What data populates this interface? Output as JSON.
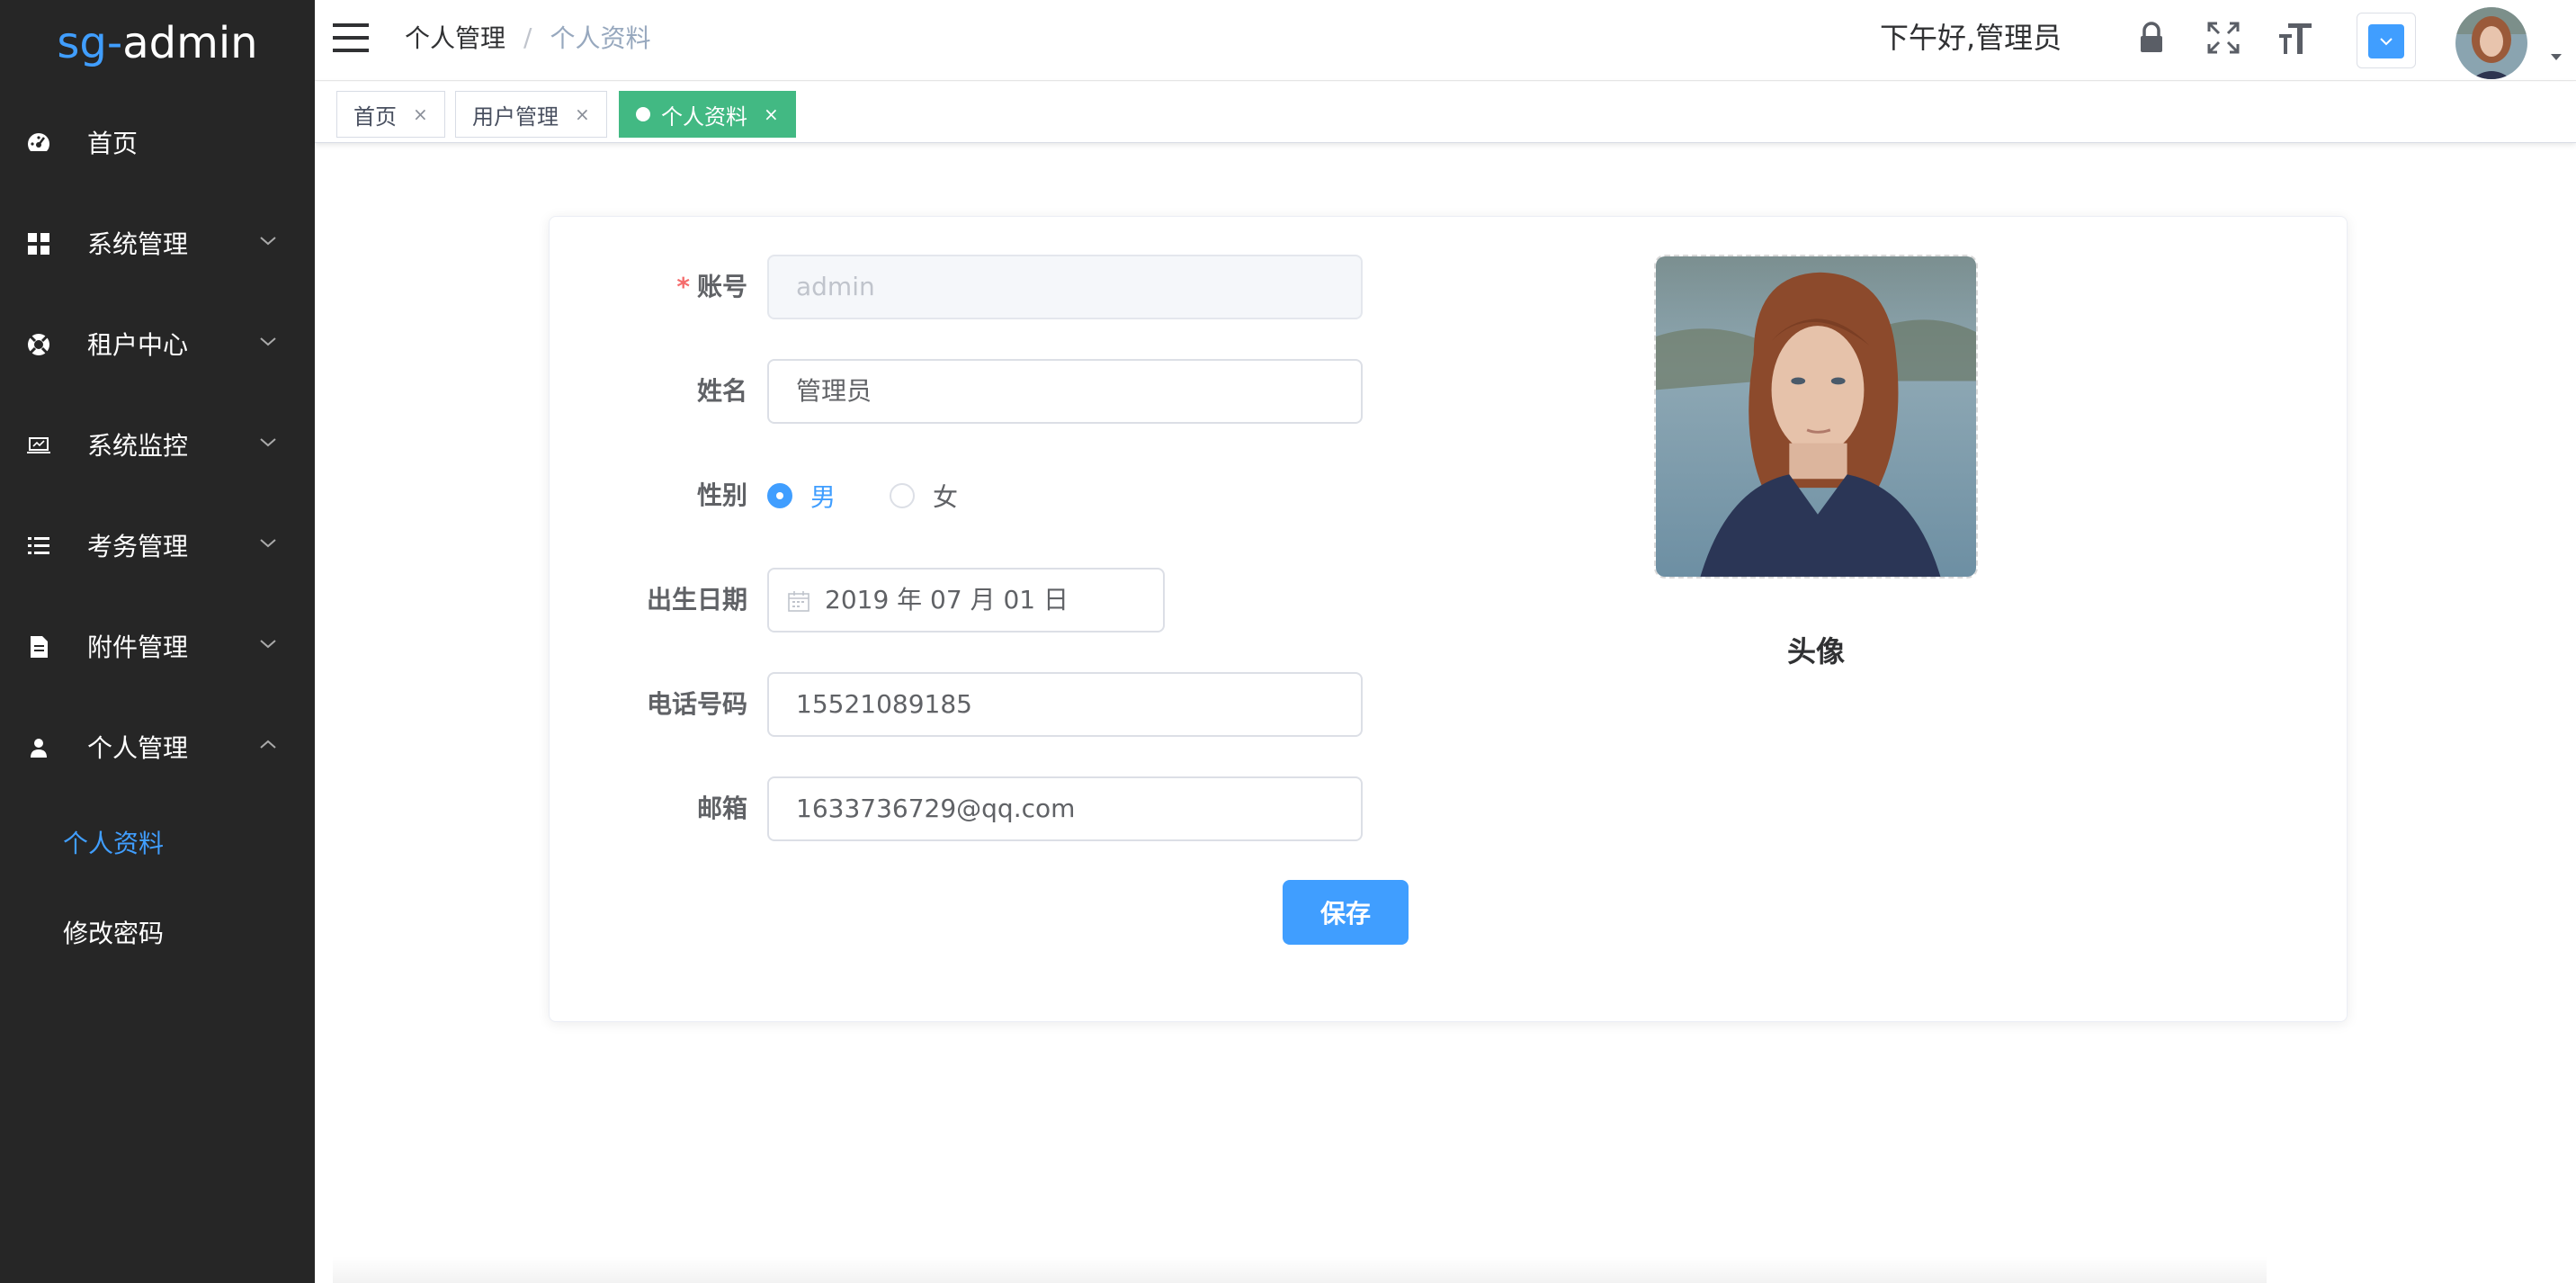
{
  "logo": {
    "prefix": "sg",
    "dash": "-",
    "suffix": "admin"
  },
  "sidebar": {
    "items": [
      {
        "label": "首页",
        "icon": "dashboard-icon",
        "has_arrow": false
      },
      {
        "label": "系统管理",
        "icon": "grid-icon",
        "has_arrow": true
      },
      {
        "label": "租户中心",
        "icon": "lifebuoy-icon",
        "has_arrow": true
      },
      {
        "label": "系统监控",
        "icon": "monitor-icon",
        "has_arrow": true
      },
      {
        "label": "考务管理",
        "icon": "list-icon",
        "has_arrow": true
      },
      {
        "label": "附件管理",
        "icon": "file-icon",
        "has_arrow": true
      },
      {
        "label": "个人管理",
        "icon": "user-icon",
        "has_arrow": true,
        "expanded": true
      }
    ],
    "sub_items": [
      {
        "label": "个人资料",
        "active": true
      },
      {
        "label": "修改密码",
        "active": false
      }
    ]
  },
  "header": {
    "breadcrumb": [
      "个人管理",
      "个人资料"
    ],
    "breadcrumb_sep": "/",
    "greeting": "下午好,管理员",
    "icons": [
      "lock-icon",
      "fullscreen-icon",
      "font-size-icon",
      "theme-dropdown-icon",
      "avatar"
    ]
  },
  "tags": [
    {
      "label": "首页",
      "close": "×",
      "active": false
    },
    {
      "label": "用户管理",
      "close": "×",
      "active": false
    },
    {
      "label": "个人资料",
      "close": "×",
      "active": true
    }
  ],
  "form": {
    "account_label": "账号",
    "account_required_mark": "*",
    "account_value": "admin",
    "name_label": "姓名",
    "name_value": "管理员",
    "gender_label": "性别",
    "gender_options": [
      "男",
      "女"
    ],
    "gender_selected": "男",
    "birthday_label": "出生日期",
    "birthday_value": "2019 年 07 月 01 日",
    "phone_label": "电话号码",
    "phone_value": "15521089185",
    "email_label": "邮箱",
    "email_value": "1633736729@qq.com",
    "save_label": "保存",
    "avatar_caption": "头像"
  },
  "colors": {
    "sidebar_bg": "#262626",
    "accent": "#409eff",
    "tag_active": "#42b983",
    "required": "#f56c6c"
  }
}
